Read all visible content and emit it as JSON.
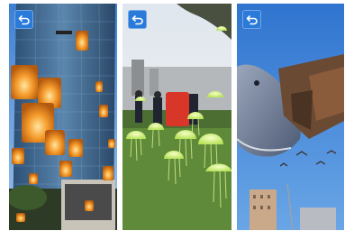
{
  "screens": [
    {
      "id": "lanterns",
      "back_icon": "back-arrow-icon",
      "theme": "city-lanterns"
    },
    {
      "id": "jellyfish",
      "back_icon": "back-arrow-icon",
      "theme": "park-jellyfish"
    },
    {
      "id": "whale",
      "back_icon": "back-arrow-icon",
      "theme": "sky-whale"
    }
  ],
  "colors": {
    "back_button": "#2a7ad9",
    "sky_blue": "#3f86d6",
    "lantern": "#f08a1c",
    "jellyfish": "#d9f28a",
    "grass": "#5f8a3a"
  }
}
